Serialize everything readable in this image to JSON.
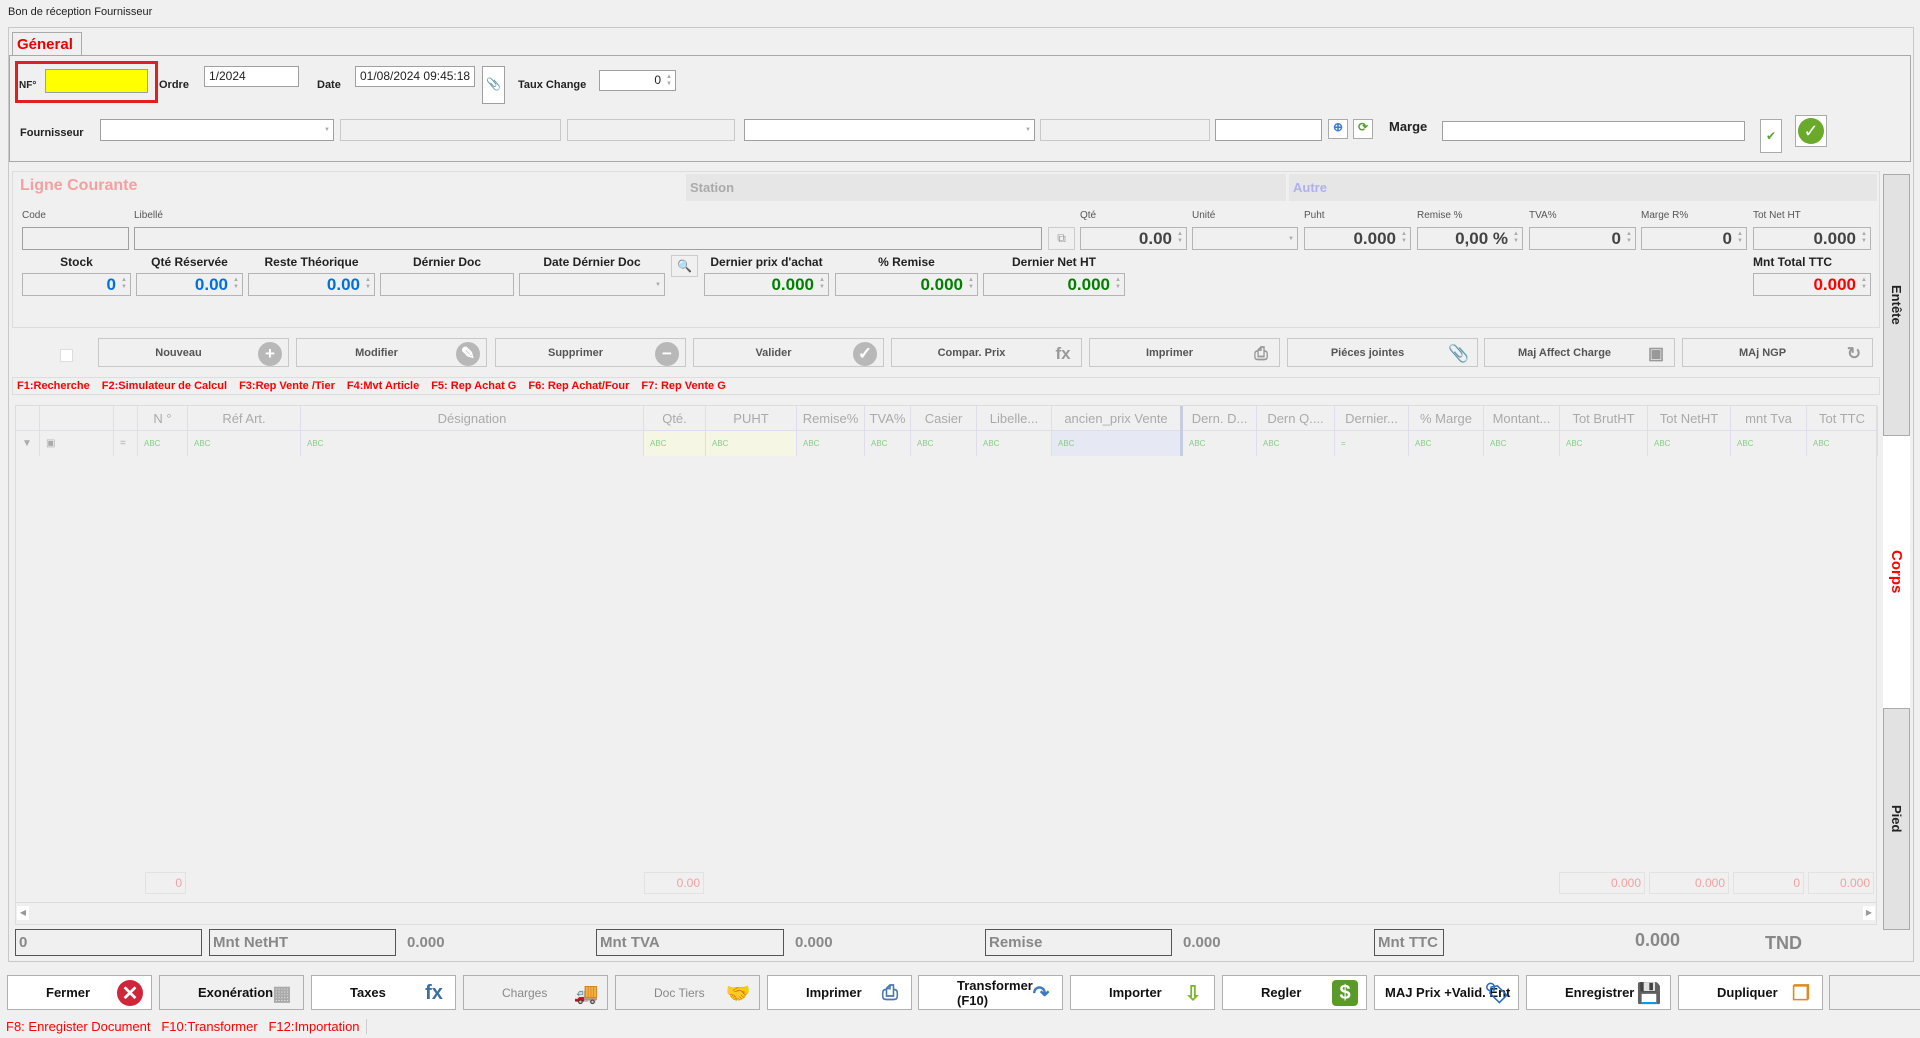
{
  "window_title": "Bon de réception Fournisseur",
  "tab_general": "Géneral",
  "header": {
    "nf_label": "NF°",
    "nf_value": "",
    "ordre_label": "Ordre",
    "ordre_value": "1/2024",
    "date_label": "Date",
    "date_value": "01/08/2024 09:45:18",
    "taux_label": "Taux Change",
    "taux_value": "0",
    "fournisseur_label": "Fournisseur",
    "marge_label": "Marge",
    "marge_value": ""
  },
  "ligne": {
    "title": "Ligne Courante",
    "station": "Station",
    "autre": "Autre",
    "code_label": "Code",
    "libelle_label": "Libellé",
    "fields": [
      {
        "label": "Qté",
        "value": "0.00"
      },
      {
        "label": "Unité",
        "value": ""
      },
      {
        "label": "Puht",
        "value": "0.000"
      },
      {
        "label": "Remise %",
        "value": "0,00 %"
      },
      {
        "label": "TVA%",
        "value": "0"
      },
      {
        "label": "Marge R%",
        "value": "0"
      },
      {
        "label": "Tot Net HT",
        "value": "0.000"
      }
    ],
    "stats": [
      {
        "label": "Stock",
        "value": "0",
        "color": "#0070e0"
      },
      {
        "label": "Qté Réservée",
        "value": "0.00",
        "color": "#0070e0"
      },
      {
        "label": "Reste Théorique",
        "value": "0.00",
        "color": "#0070e0"
      },
      {
        "label": "Dérnier Doc",
        "value": "",
        "color": "#000"
      },
      {
        "label": "Date Dérnier Doc",
        "value": "",
        "color": "#000"
      },
      {
        "label": "Dernier prix d'achat",
        "value": "0.000",
        "color": "#008000"
      },
      {
        "label": "% Remise",
        "value": "0.000",
        "color": "#008000"
      },
      {
        "label": "Dernier Net HT",
        "value": "0.000",
        "color": "#008000"
      }
    ],
    "mnt_total_label": "Mnt Total  TTC",
    "mnt_total_value": "0.000"
  },
  "actions": [
    {
      "label": "Nouveau",
      "icon": "plus-circle-icon",
      "glyph": "+"
    },
    {
      "label": "Modifier",
      "icon": "edit-grid-icon",
      "glyph": "✎"
    },
    {
      "label": "Supprimer",
      "icon": "minus-circle-icon",
      "glyph": "−"
    },
    {
      "label": "Valider",
      "icon": "check-circle-icon",
      "glyph": "✓"
    },
    {
      "label": "Compar. Prix",
      "icon": "calculator-fx-icon",
      "glyph": "fx"
    },
    {
      "label": "Imprimer",
      "icon": "printer-icon",
      "glyph": "⎙"
    },
    {
      "label": "Piéces jointes",
      "icon": "paperclip-icon",
      "glyph": "📎"
    },
    {
      "label": "Maj Affect Charge",
      "icon": "bus-icon",
      "glyph": "▣"
    },
    {
      "label": "MAj NGP",
      "icon": "refresh-icon",
      "glyph": "↻"
    }
  ],
  "shortcuts": [
    "F1:Recherche",
    "F2:Simulateur de Calcul",
    "F3:Rep Vente /Tier",
    "F4:Mvt Article",
    "F5: Rep Achat G",
    "F6: Rep Achat/Four",
    "F7: Rep Vente G"
  ],
  "grid": {
    "columns": [
      "",
      "",
      "",
      "N °",
      "Réf Art.",
      "Désignation",
      "Qté.",
      "PUHT",
      "Remise%",
      "TVA%",
      "Casier",
      "Libelle...",
      "ancien_prix Vente",
      "Dern. D...",
      "Dern Q....",
      "Dernier...",
      "% Marge",
      "Montant...",
      "Tot BrutHT",
      "Tot NetHT",
      "mnt Tva",
      "Tot TTC"
    ],
    "totals": {
      "n": "0",
      "qte": "0.00",
      "tot_brut": "0.000",
      "tot_net": "0.000",
      "mnt_tva": "0",
      "tot_ttc": "0.000"
    }
  },
  "footer": {
    "count": "0",
    "mnt_netht_label": "Mnt NetHT",
    "mnt_netht": "0.000",
    "mnt_tva_label": "Mnt TVA",
    "mnt_tva": "0.000",
    "remise_label": "Remise",
    "remise": "0.000",
    "mnt_ttc_label": "Mnt TTC",
    "mnt_ttc": "0.000",
    "currency": "TND"
  },
  "side_tabs": {
    "entete": "Entête",
    "corps": "Corps",
    "pied": "Pied"
  },
  "bottom_buttons": [
    {
      "label": "Fermer",
      "icon": "close-circle-icon",
      "glyph": "✕",
      "color": "#d0263a",
      "disabled": false
    },
    {
      "label": "Exonération",
      "icon": "grid-icon",
      "glyph": "▦",
      "color": "#aaaaaa",
      "disabled": false
    },
    {
      "label": "Taxes",
      "icon": "fx-plus-icon",
      "glyph": "fx",
      "color": "#3a6ea5",
      "disabled": false
    },
    {
      "label": "Charges",
      "icon": "truck-icon",
      "glyph": "🚚",
      "color": "#aaaaaa",
      "disabled": true
    },
    {
      "label": "Doc Tiers",
      "icon": "handshake-icon",
      "glyph": "🤝",
      "color": "#aaaaaa",
      "disabled": true
    },
    {
      "label": "Imprimer",
      "icon": "printer-icon",
      "glyph": "⎙",
      "color": "#4a78b0",
      "disabled": false
    },
    {
      "label": "Transformer (F10)",
      "icon": "redo-arrow-icon",
      "glyph": "↷",
      "color": "#3a7ac0",
      "disabled": false
    },
    {
      "label": "Importer",
      "icon": "download-arrow-icon",
      "glyph": "⇩",
      "color": "#7cb42a",
      "disabled": false
    },
    {
      "label": "Regler",
      "icon": "money-icon",
      "glyph": "$",
      "color": "#5a9a2a",
      "disabled": false
    },
    {
      "label": "MAJ Prix +Valid. Ent",
      "icon": "price-tag-icon",
      "glyph": "🏷",
      "color": "#2a6ac0",
      "disabled": false
    },
    {
      "label": "Enregistrer",
      "icon": "save-icon",
      "glyph": "💾",
      "color": "#555555",
      "disabled": false
    },
    {
      "label": "Dupliquer",
      "icon": "copy-icon",
      "glyph": "❐",
      "color": "#e08a20",
      "disabled": false
    },
    {
      "label": "",
      "icon": "folder-open-icon",
      "glyph": "📂",
      "color": "#bbbbbb",
      "disabled": true
    }
  ],
  "bottom_shortcuts": "F8: Enregister Document   F10:Transformer   F12:Importation"
}
